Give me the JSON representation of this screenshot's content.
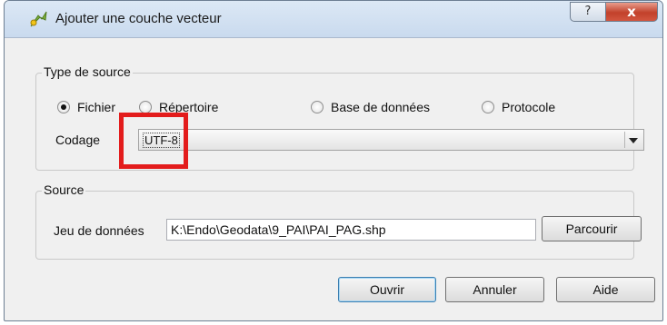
{
  "window": {
    "title": "Ajouter une couche vecteur",
    "help_label": "?",
    "close_label": "x"
  },
  "source_type": {
    "legend": "Type de source",
    "options": [
      {
        "label": "Fichier",
        "checked": true
      },
      {
        "label": "Répertoire",
        "checked": false
      },
      {
        "label": "Base de données",
        "checked": false
      },
      {
        "label": "Protocole",
        "checked": false
      }
    ],
    "encoding_label": "Codage",
    "encoding_value": "UTF-8"
  },
  "source": {
    "legend": "Source",
    "dataset_label": "Jeu de données",
    "dataset_value": "K:\\Endo\\Geodata\\9_PAI\\PAI_PAG.shp",
    "browse_label": "Parcourir"
  },
  "buttons": {
    "open": "Ouvrir",
    "cancel": "Annuler",
    "help": "Aide"
  },
  "colors": {
    "highlight": "#e31c1c",
    "close_button": "#c2412b"
  }
}
